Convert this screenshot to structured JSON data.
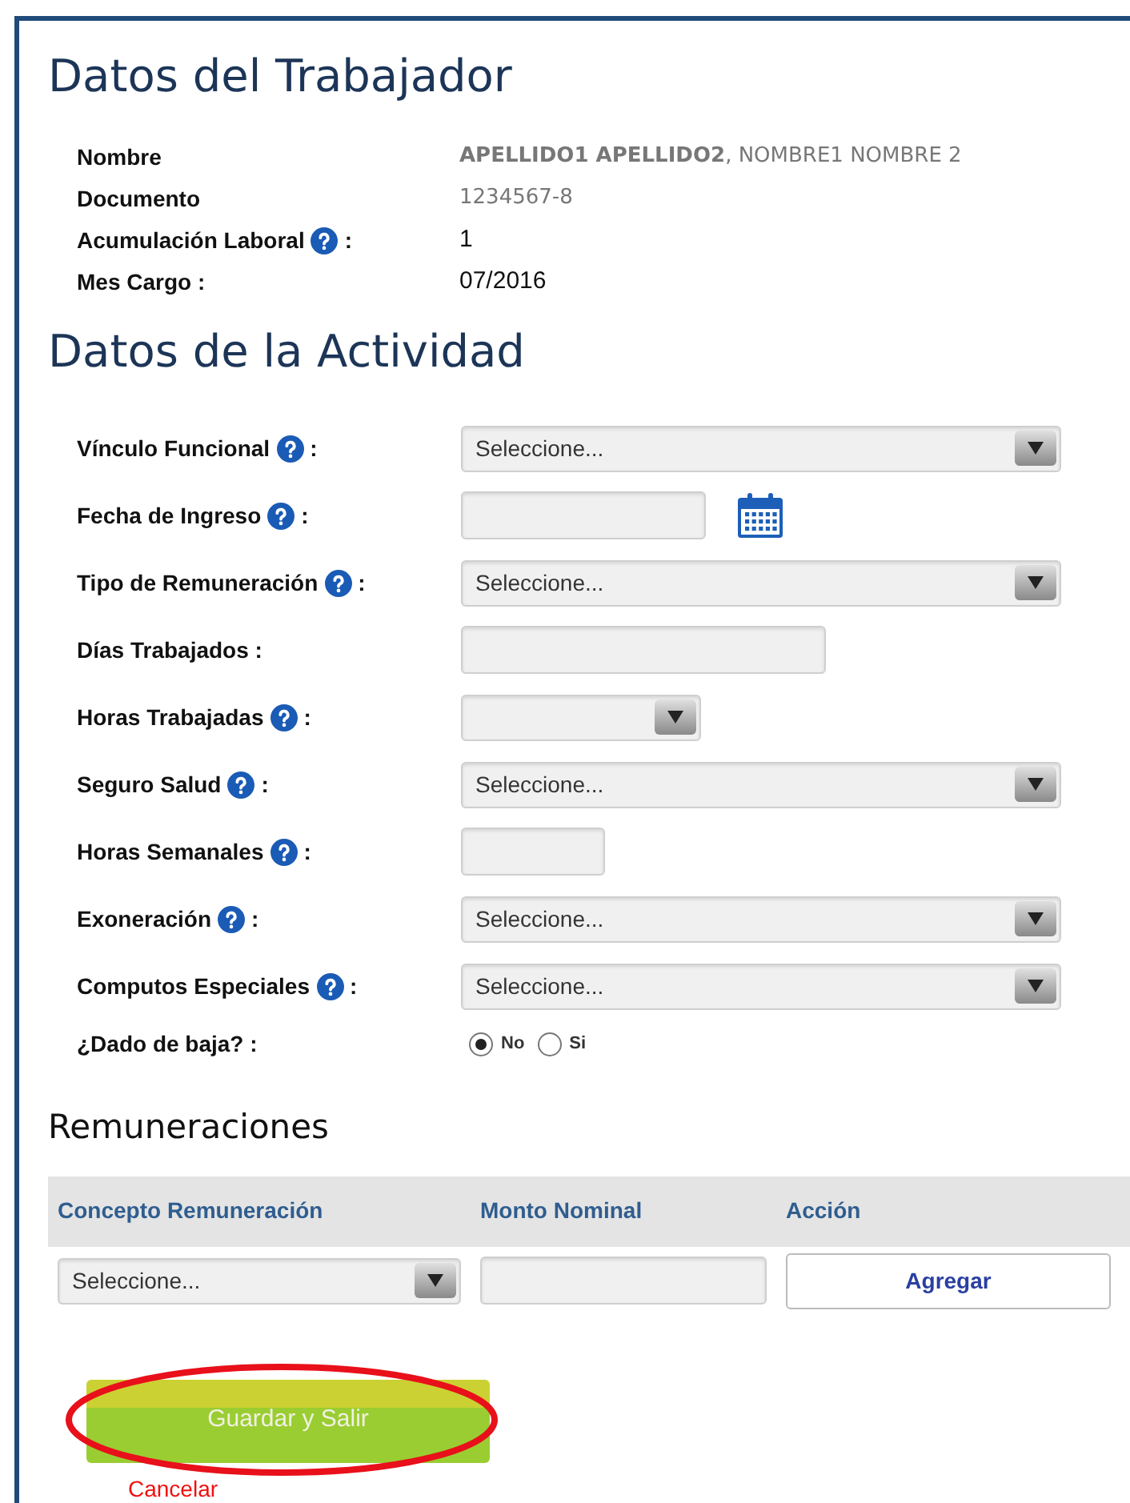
{
  "worker": {
    "title": "Datos del Trabajador",
    "items": [
      {
        "label": "Nombre",
        "help": false,
        "value": "**APELLIDO1 APELLIDO2**, NOMBRE1 NOMBRE 2",
        "muted": true
      },
      {
        "label": "Documento",
        "help": false,
        "value": "1234567-8",
        "muted": true
      },
      {
        "label": "Acumulación Laboral",
        "help": true,
        "suffix": ":",
        "value": "1",
        "muted": false
      },
      {
        "label": "Mes Cargo :",
        "help": false,
        "value": "07/2016",
        "muted": false
      }
    ]
  },
  "activity": {
    "title": "Datos de la Actividad",
    "fields": [
      {
        "label": "Vínculo Funcional",
        "help": true,
        "suffix": ":",
        "kind": "select",
        "value": "Seleccione..."
      },
      {
        "label": "Fecha de Ingreso",
        "help": true,
        "suffix": ":",
        "kind": "date"
      },
      {
        "label": "Tipo de Remuneración",
        "help": true,
        "suffix": ":",
        "kind": "select",
        "value": "Seleccione..."
      },
      {
        "label": "Días Trabajados :",
        "help": false,
        "kind": "text"
      },
      {
        "label": "Horas Trabajadas",
        "help": true,
        "suffix": ":",
        "kind": "short-select"
      },
      {
        "label": "Seguro Salud",
        "help": true,
        "suffix": ":",
        "kind": "select",
        "value": "Seleccione..."
      },
      {
        "label": "Horas Semanales",
        "help": true,
        "suffix": ":",
        "kind": "short-text"
      },
      {
        "label": "Exoneración",
        "help": true,
        "suffix": ":",
        "kind": "select",
        "value": "Seleccione..."
      },
      {
        "label": "Computos Especiales",
        "help": true,
        "suffix": ":",
        "kind": "select",
        "value": "Seleccione..."
      },
      {
        "label": "¿Dado de baja? :",
        "help": false,
        "kind": "radio",
        "options": [
          {
            "label": "No",
            "selected": true
          },
          {
            "label": "Si",
            "selected": false
          }
        ]
      }
    ]
  },
  "remuneraciones": {
    "title": "Remuneraciones",
    "columns": [
      "Concepto Remuneración",
      "Monto Nominal",
      "Acción"
    ],
    "concept_select": "Seleccione...",
    "add_button": "Agregar"
  },
  "save_button": {
    "label": "Guardar y Salir",
    "highlighted": true
  },
  "cancel_link": "Cancelar"
}
